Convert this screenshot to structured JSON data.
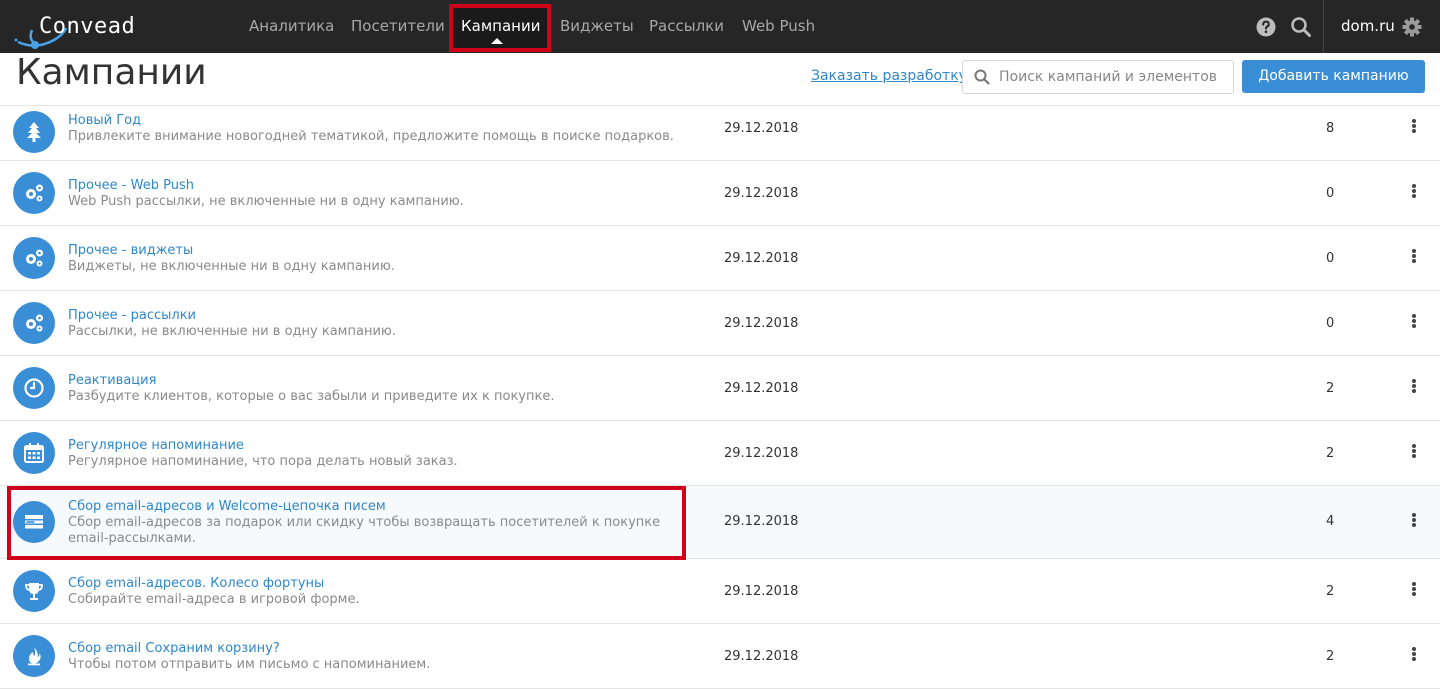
{
  "app": {
    "logo_text": "Convead",
    "account": "dom.ru"
  },
  "nav": {
    "items": [
      {
        "label": "Аналитика"
      },
      {
        "label": "Посетители"
      },
      {
        "label": "Кампании"
      },
      {
        "label": "Виджеты"
      },
      {
        "label": "Рассылки"
      },
      {
        "label": "Web Push"
      }
    ],
    "active": "Кампании"
  },
  "header": {
    "title": "Кампании",
    "order_link": "Заказать разработку",
    "search_placeholder": "Поиск кампаний и элементов",
    "add_button": "Добавить кампанию"
  },
  "icons": {
    "help": "question-circle-icon",
    "search": "search-icon",
    "settings": "gear-icon"
  },
  "colors": {
    "accent": "#3a8ed6",
    "link": "#2f87c9",
    "topbar": "#262626",
    "highlight_frame": "#d0021b"
  },
  "campaigns": [
    {
      "title": "Новый Год",
      "description": "Привлеките внимание новогодней тематикой, предложите помощь в поиске подарков.",
      "date": "29.12.2018",
      "count": "8",
      "icon": "tree-icon"
    },
    {
      "title": "Прочее - Web Push",
      "description": "Web Push рассылки, не включенные ни в одну кампанию.",
      "date": "29.12.2018",
      "count": "0",
      "icon": "gears-icon"
    },
    {
      "title": "Прочее - виджеты",
      "description": "Виджеты, не включенные ни в одну кампанию.",
      "date": "29.12.2018",
      "count": "0",
      "icon": "gears-icon"
    },
    {
      "title": "Прочее - рассылки",
      "description": "Рассылки, не включенные ни в одну кампанию.",
      "date": "29.12.2018",
      "count": "0",
      "icon": "gears-icon"
    },
    {
      "title": "Реактивация",
      "description": "Разбудите клиентов, которые о вас забыли и приведите их к покупке.",
      "date": "29.12.2018",
      "count": "2",
      "icon": "clock-icon"
    },
    {
      "title": "Регулярное напоминание",
      "description": "Регулярное напоминание, что пора делать новый заказ.",
      "date": "29.12.2018",
      "count": "2",
      "icon": "calendar-icon"
    },
    {
      "title": "Сбор email-адресов и Welcome-цепочка писем",
      "description": "Сбор email-адресов за подарок или скидку чтобы возвращать посетителей к покупке email-рассылками.",
      "date": "29.12.2018",
      "count": "4",
      "icon": "form-icon",
      "highlighted": true
    },
    {
      "title": "Сбор email-адресов. Колесо фортуны",
      "description": "Собирайте email-адреса в игровой форме.",
      "date": "29.12.2018",
      "count": "2",
      "icon": "trophy-icon"
    },
    {
      "title": "Сбор email Сохраним корзину?",
      "description": "Чтобы потом отправить им письмо с напоминанием.",
      "date": "29.12.2018",
      "count": "2",
      "icon": "fire-icon"
    }
  ]
}
